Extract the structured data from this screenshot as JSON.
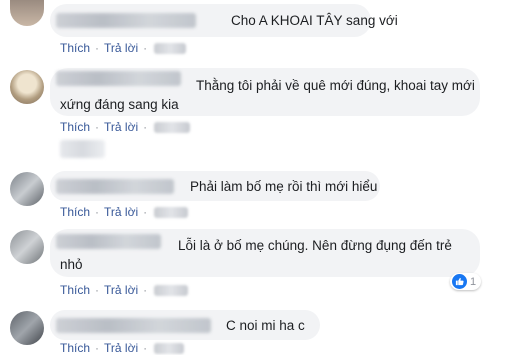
{
  "actions": {
    "like_label": "Thích",
    "reply_label": "Trả lời",
    "separator": "·"
  },
  "comments": [
    {
      "text_line1": "Cho A KHOAI TÂY sang với",
      "text_line2": ""
    },
    {
      "text_line1": "Thằng tôi phải về quê mới đúng, khoai tay mới",
      "text_line2": "xứng đáng sang kia"
    },
    {
      "text_line1": "Phải làm bố mẹ rồi thì mới hiểu",
      "text_line2": ""
    },
    {
      "text_line1": "Lỗi là ở bố mẹ chúng. Nên đừng đụng đến trẻ",
      "text_line2": "nhỏ",
      "reaction": {
        "icon": "thumbs-up-icon",
        "count": "1"
      }
    },
    {
      "text_line1": "C noi mi ha c",
      "text_line2": ""
    }
  ],
  "colors": {
    "link": "#385898",
    "bubble": "#f2f3f5",
    "text": "#1c1e21",
    "like_blue": "#1877f2"
  }
}
